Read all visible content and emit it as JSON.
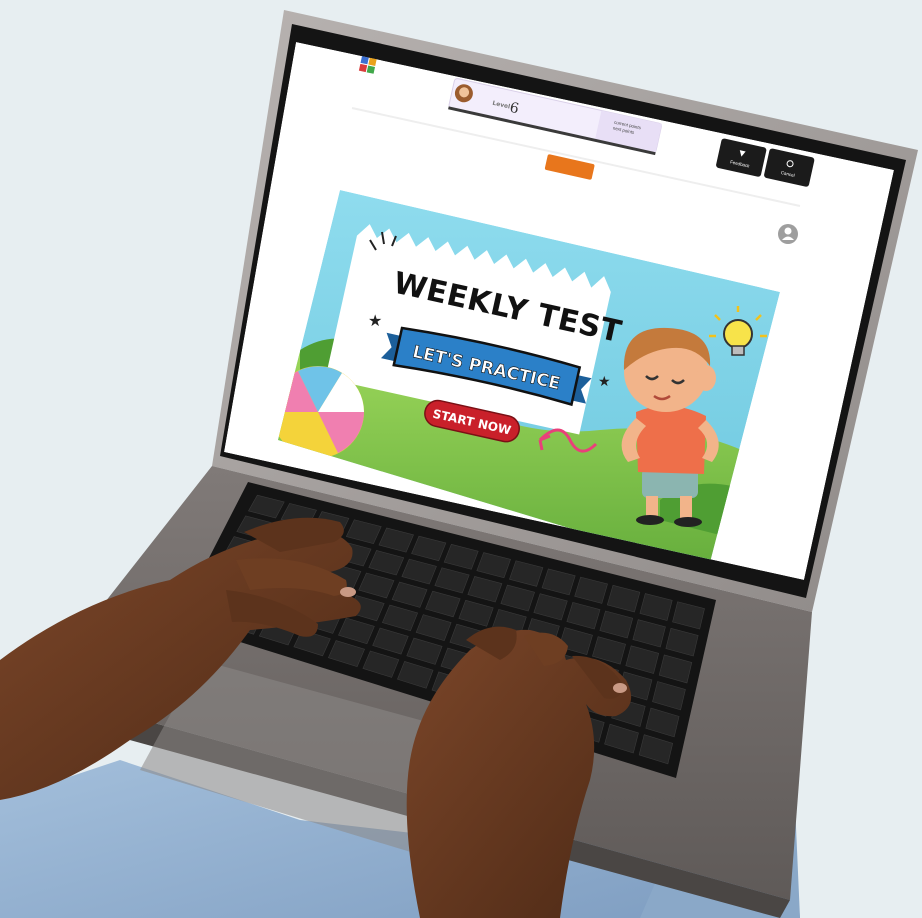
{
  "scene": {
    "background_color": "#e7eef1",
    "laptop_color": "#a8a3a1",
    "screen_bezel_color": "#141414",
    "keyboard_color": "#141414",
    "skin_color": "#6b3b22",
    "jeans_color": "#9db9d6"
  },
  "app": {
    "logo_icon": "app-logo-icon",
    "level_label": "Level",
    "level_value": "6",
    "points_line1": "current points",
    "points_line2": "next points",
    "buttons": [
      {
        "icon": "feedback-icon",
        "label": "Feedback"
      },
      {
        "icon": "cancel-icon",
        "label": "Cancel"
      }
    ],
    "accent_color": "#e8761c"
  },
  "banner": {
    "title": "WEEKLY TEST",
    "ribbon": "LET'S PRACTICE",
    "cta": "START NOW",
    "cta_color": "#c9202a",
    "ribbon_color": "#2b80c8",
    "sky_color": "#7fd3e6",
    "grass_color": "#7cc64a"
  }
}
